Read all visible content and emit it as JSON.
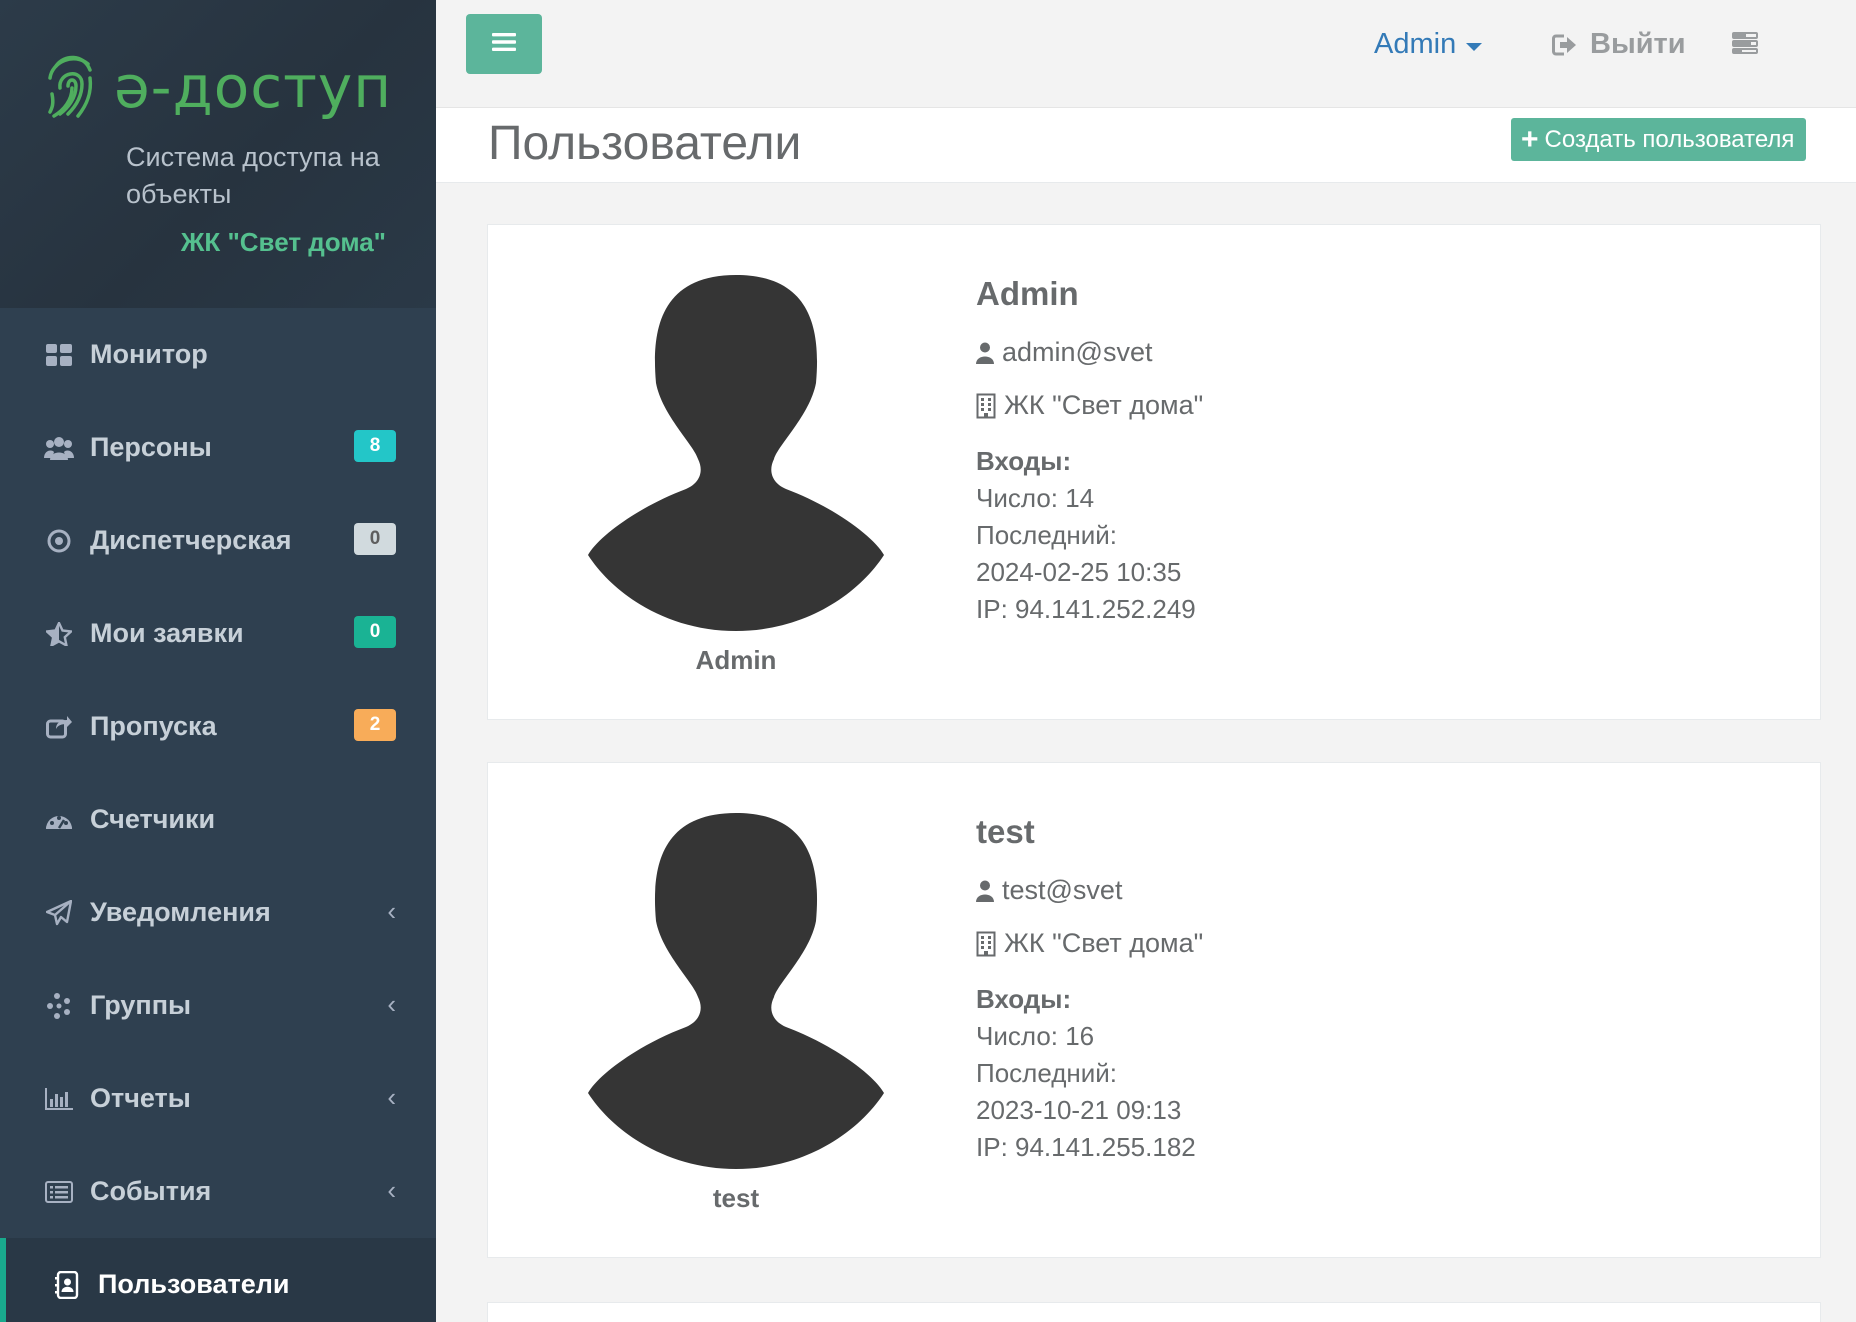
{
  "brand": {
    "logo_text": "ә-доступ",
    "subtitle": "Система доступа на объекты",
    "org": "ЖК \"Свет дома\""
  },
  "nav": {
    "items": [
      {
        "label": "Монитор",
        "icon": "dashboard-icon"
      },
      {
        "label": "Персоны",
        "icon": "users-icon",
        "badge": "8",
        "badge_color": "#23c6c8"
      },
      {
        "label": "Диспетчерская",
        "icon": "target-icon",
        "badge": "0",
        "badge_color": "#d1dade"
      },
      {
        "label": "Мои заявки",
        "icon": "star-icon",
        "badge": "0",
        "badge_color": "#1ab394"
      },
      {
        "label": "Пропуска",
        "icon": "share-icon",
        "badge": "2",
        "badge_color": "#f8ac59"
      },
      {
        "label": "Счетчики",
        "icon": "gauge-icon"
      },
      {
        "label": "Уведомления",
        "icon": "paper-plane-icon",
        "chevron": "‹"
      },
      {
        "label": "Группы",
        "icon": "asterisk-icon",
        "chevron": "‹"
      },
      {
        "label": "Отчеты",
        "icon": "bar-chart-icon",
        "chevron": "‹"
      },
      {
        "label": "События",
        "icon": "list-icon",
        "chevron": "‹"
      },
      {
        "label": "Пользователи",
        "icon": "address-book-icon",
        "active": true
      }
    ]
  },
  "topbar": {
    "user": "Admin",
    "logout": "Выйти"
  },
  "page": {
    "title": "Пользователи",
    "create_button": "Создать пользователя"
  },
  "users": [
    {
      "name": "Admin",
      "login": "admin@svet",
      "org": "ЖК \"Свет дома\"",
      "logins_label": "Входы:",
      "count": "Число: 14",
      "last_label": "Последний:",
      "last_date": "2024-02-25 10:35",
      "ip": "IP: 94.141.252.249"
    },
    {
      "name": "test",
      "login": "test@svet",
      "org": "ЖК \"Свет дома\"",
      "logins_label": "Входы:",
      "count": "Число: 16",
      "last_label": "Последний:",
      "last_date": "2023-10-21 09:13",
      "ip": "IP: 94.141.255.182"
    }
  ],
  "colors": {
    "sidebar_bg": "#2f4050",
    "accent": "#5cb59b",
    "link": "#337ab7"
  }
}
